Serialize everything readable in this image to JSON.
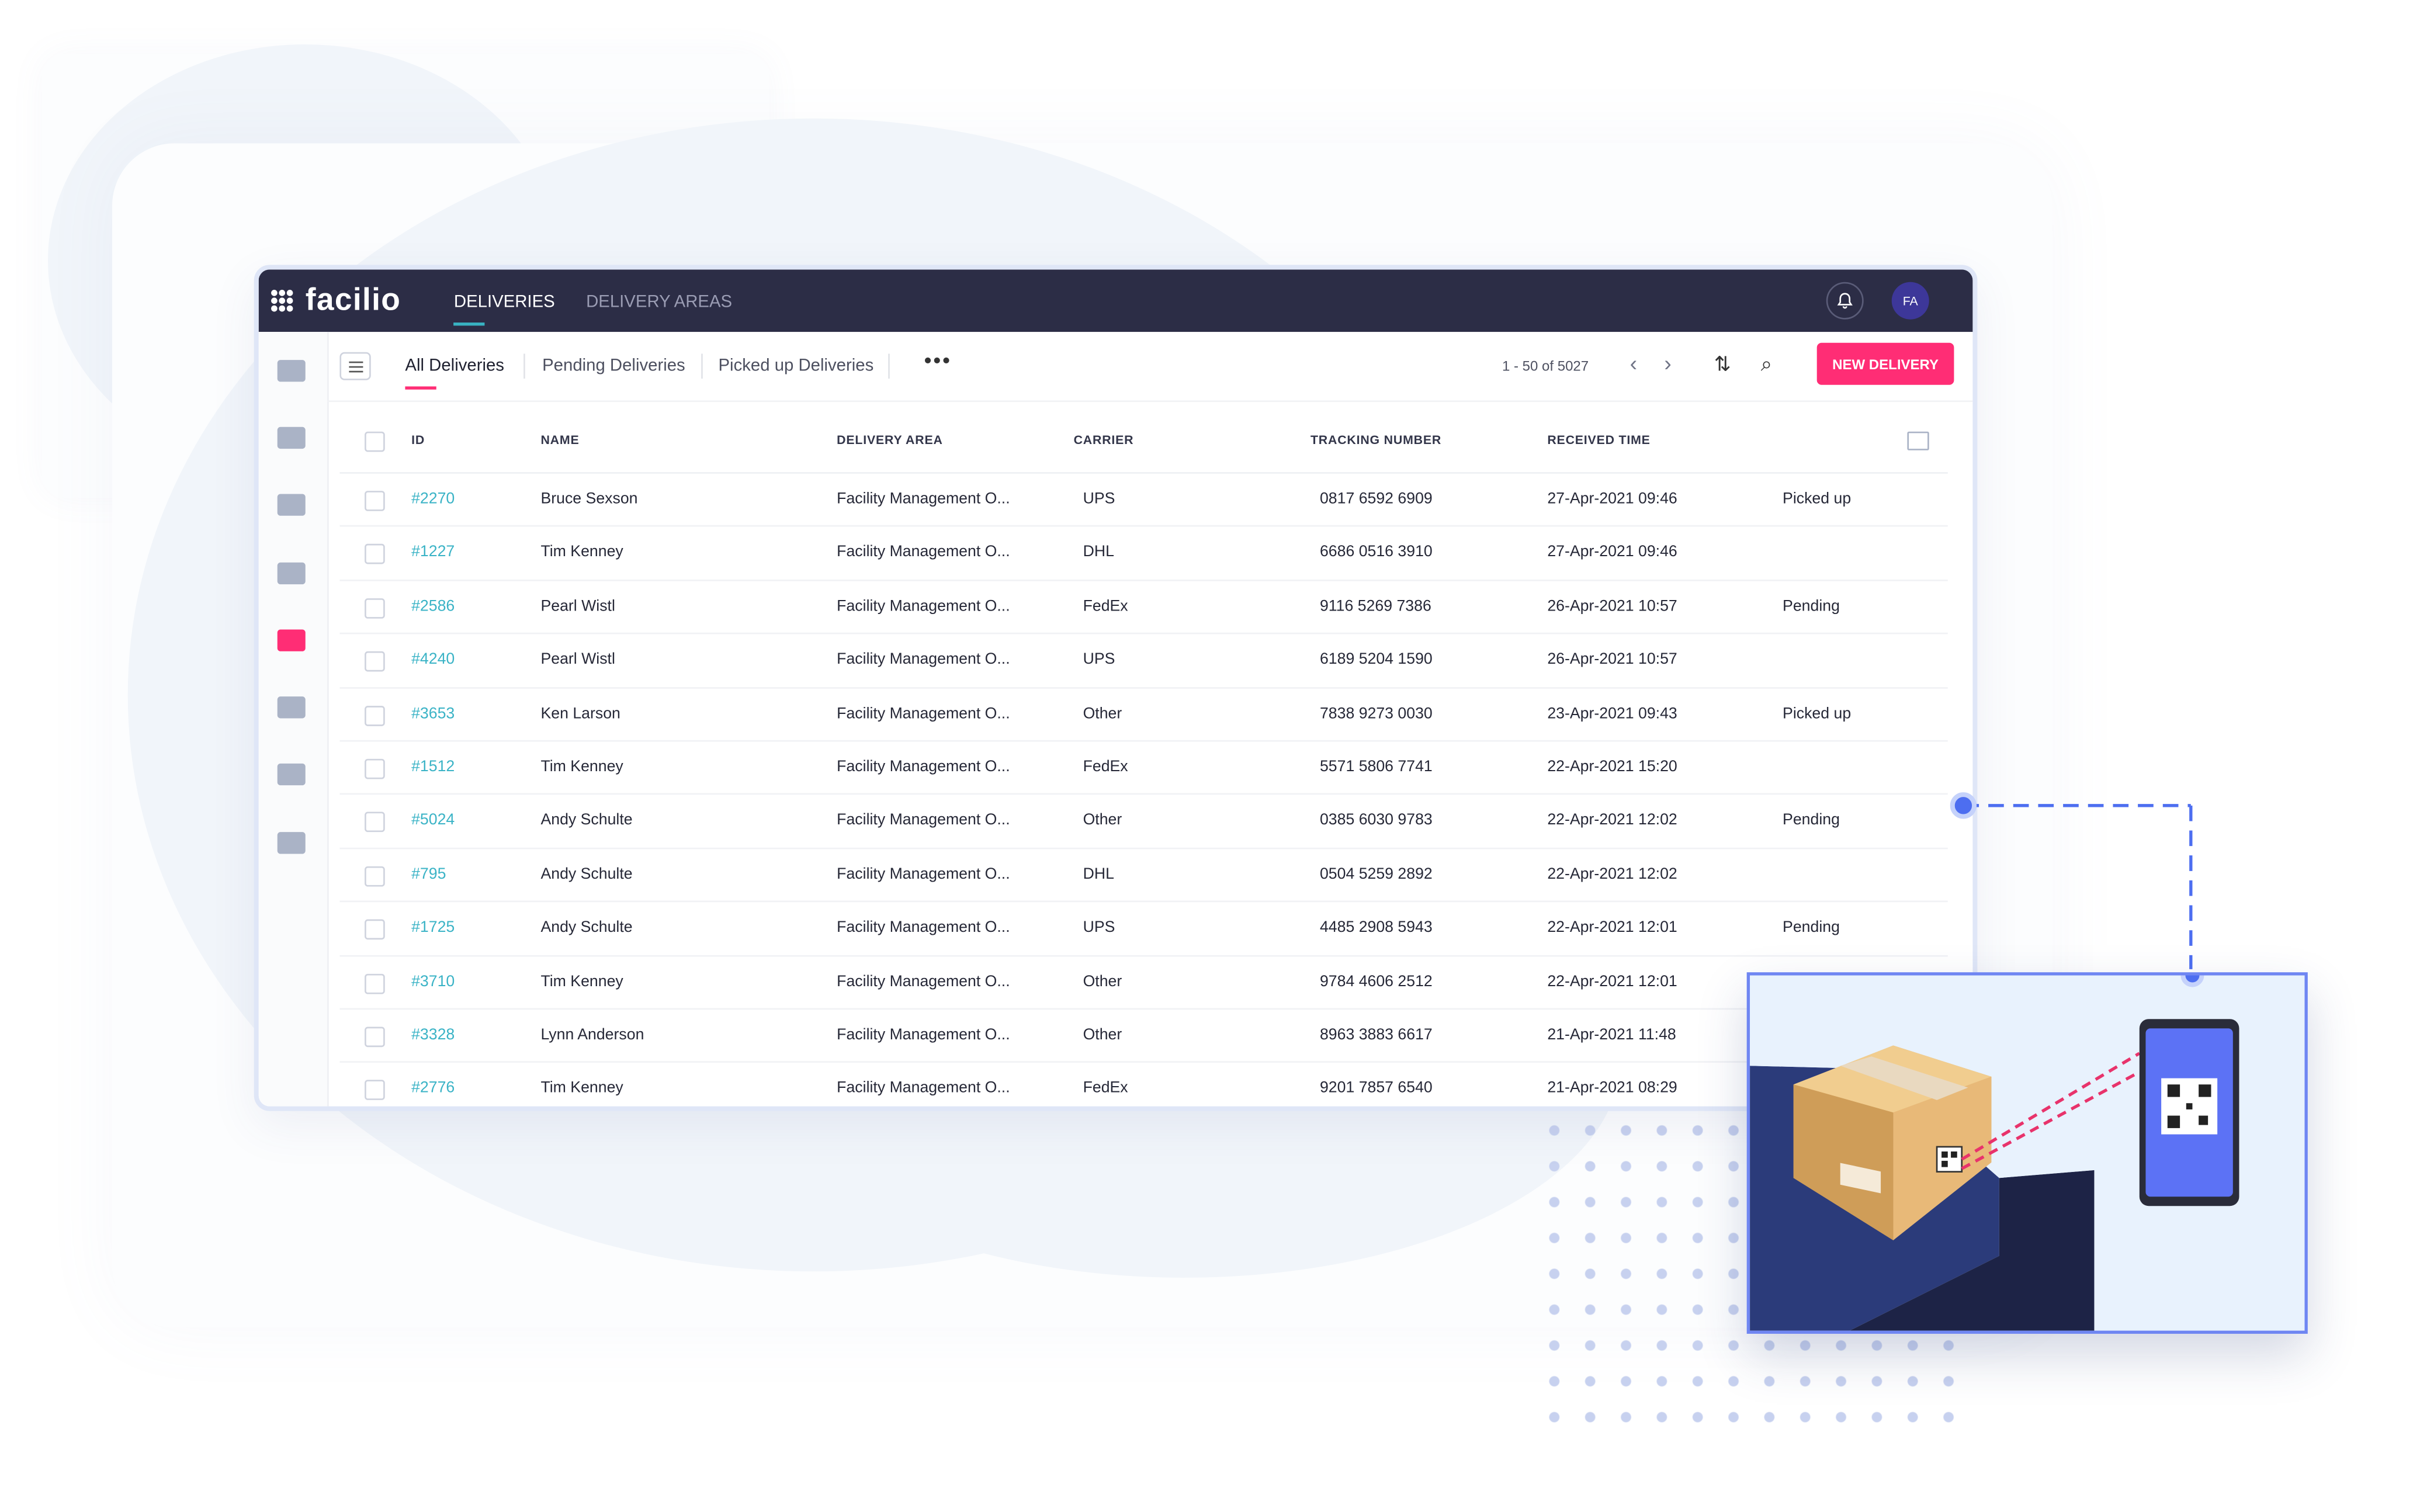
{
  "app": {
    "brand": "facilio",
    "tabs": [
      {
        "label": "DELIVERIES"
      },
      {
        "label": "DELIVERY AREAS"
      }
    ],
    "avatar_initials": "FA"
  },
  "views": [
    {
      "label": "All Deliveries"
    },
    {
      "label": "Pending Deliveries"
    },
    {
      "label": "Picked up Deliveries"
    }
  ],
  "more_label": "•••",
  "pagination": {
    "text": "1 - 50 of 5027"
  },
  "new_button": "NEW DELIVERY",
  "table": {
    "headers": {
      "id": "ID",
      "name": "NAME",
      "area": "DELIVERY AREA",
      "carrier": "CARRIER",
      "tracking": "TRACKING NUMBER",
      "received": "RECEIVED TIME"
    },
    "rows": [
      {
        "id": "#2270",
        "name": "Bruce Sexson",
        "area": "Facility Management O...",
        "carrier": "UPS",
        "tracking": "0817 6592 6909",
        "received": "27-Apr-2021 09:46",
        "status": "Picked up"
      },
      {
        "id": "#1227",
        "name": "Tim Kenney",
        "area": "Facility Management O...",
        "carrier": "DHL",
        "tracking": "6686 0516 3910",
        "received": "27-Apr-2021 09:46",
        "status": ""
      },
      {
        "id": "#2586",
        "name": "Pearl Wistl",
        "area": "Facility Management O...",
        "carrier": "FedEx",
        "tracking": "9116 5269 7386",
        "received": "26-Apr-2021 10:57",
        "status": "Pending"
      },
      {
        "id": "#4240",
        "name": "Pearl Wistl",
        "area": "Facility Management O...",
        "carrier": "UPS",
        "tracking": "6189 5204 1590",
        "received": "26-Apr-2021 10:57",
        "status": ""
      },
      {
        "id": "#3653",
        "name": "Ken Larson",
        "area": "Facility Management O...",
        "carrier": "Other",
        "tracking": "7838 9273 0030",
        "received": "23-Apr-2021 09:43",
        "status": "Picked up"
      },
      {
        "id": "#1512",
        "name": "Tim Kenney",
        "area": "Facility Management O...",
        "carrier": "FedEx",
        "tracking": "5571 5806 7741",
        "received": "22-Apr-2021 15:20",
        "status": ""
      },
      {
        "id": "#5024",
        "name": "Andy Schulte",
        "area": "Facility Management O...",
        "carrier": "Other",
        "tracking": "0385 6030 9783",
        "received": "22-Apr-2021 12:02",
        "status": "Pending"
      },
      {
        "id": "#795",
        "name": "Andy Schulte",
        "area": "Facility Management O...",
        "carrier": "DHL",
        "tracking": "0504 5259 2892",
        "received": "22-Apr-2021 12:02",
        "status": ""
      },
      {
        "id": "#1725",
        "name": "Andy Schulte",
        "area": "Facility Management O...",
        "carrier": "UPS",
        "tracking": "4485 2908 5943",
        "received": "22-Apr-2021 12:01",
        "status": "Pending"
      },
      {
        "id": "#3710",
        "name": "Tim Kenney",
        "area": "Facility Management O...",
        "carrier": "Other",
        "tracking": "9784 4606 2512",
        "received": "22-Apr-2021 12:01",
        "status": ""
      },
      {
        "id": "#3328",
        "name": "Lynn Anderson",
        "area": "Facility Management O...",
        "carrier": "Other",
        "tracking": "8963 3883 6617",
        "received": "21-Apr-2021 11:48",
        "status": ""
      },
      {
        "id": "#2776",
        "name": "Tim Kenney",
        "area": "Facility Management O...",
        "carrier": "FedEx",
        "tracking": "9201 7857 6540",
        "received": "21-Apr-2021 08:29",
        "status": ""
      }
    ]
  },
  "sidebar": {
    "icons": [
      "building-icon",
      "dashboard-icon",
      "list-icon",
      "visitor-icon",
      "delivery-truck-icon",
      "contracts-icon",
      "people-icon",
      "analytics-icon"
    ],
    "active_icon": "delivery-truck-icon"
  },
  "colors": {
    "topbar": "#2c2d46",
    "accent_pink": "#ff2d75",
    "id_link": "#3ab3c6",
    "panel_border": "#6f86f2",
    "phone_screen": "#5c72f5"
  }
}
